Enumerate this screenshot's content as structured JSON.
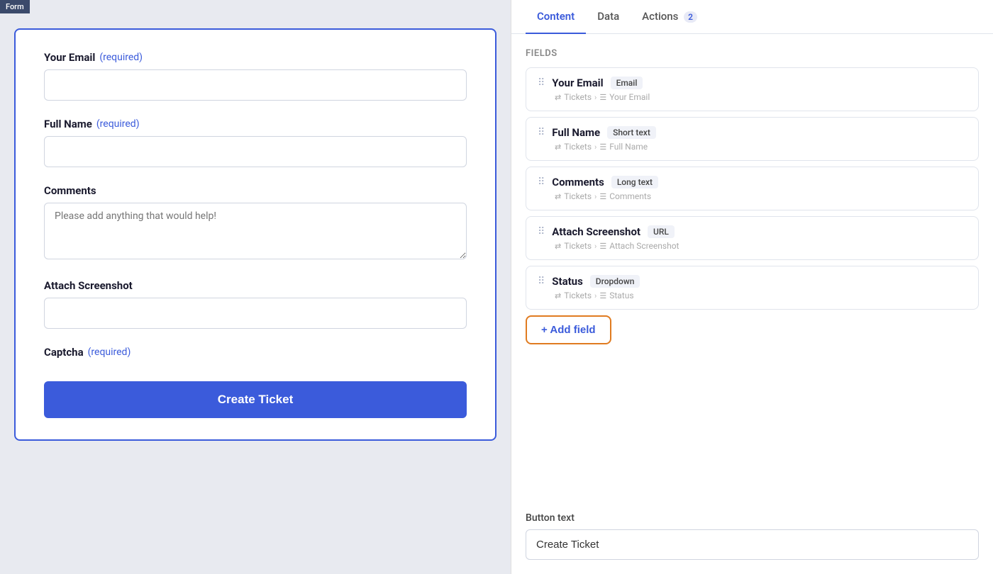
{
  "left": {
    "badge": "Form",
    "fields": [
      {
        "label": "Your Email",
        "required": true,
        "type": "input",
        "placeholder": ""
      },
      {
        "label": "Full Name",
        "required": true,
        "type": "input",
        "placeholder": ""
      },
      {
        "label": "Comments",
        "required": false,
        "type": "textarea",
        "placeholder": "Please add anything that would help!"
      },
      {
        "label": "Attach Screenshot",
        "required": false,
        "type": "input",
        "placeholder": ""
      },
      {
        "label": "Captcha",
        "required": true,
        "type": "captcha",
        "placeholder": ""
      }
    ],
    "required_text": "(required)",
    "submit_button": "Create Ticket"
  },
  "right": {
    "tabs": [
      {
        "id": "content",
        "label": "Content",
        "active": true,
        "badge": null
      },
      {
        "id": "data",
        "label": "Data",
        "active": false,
        "badge": null
      },
      {
        "id": "actions",
        "label": "Actions",
        "active": false,
        "badge": "2"
      }
    ],
    "fields_section_label": "Fields",
    "fields": [
      {
        "name": "Your Email",
        "type": "Email",
        "path_table": "Tickets",
        "path_field": "Your Email"
      },
      {
        "name": "Full Name",
        "type": "Short text",
        "path_table": "Tickets",
        "path_field": "Full Name"
      },
      {
        "name": "Comments",
        "type": "Long text",
        "path_table": "Tickets",
        "path_field": "Comments"
      },
      {
        "name": "Attach Screenshot",
        "type": "URL",
        "path_table": "Tickets",
        "path_field": "Attach Screenshot"
      },
      {
        "name": "Status",
        "type": "Dropdown",
        "path_table": "Tickets",
        "path_field": "Status"
      }
    ],
    "add_field_label": "+ Add field",
    "button_text_label": "Button text",
    "button_text_value": "Create Ticket"
  }
}
